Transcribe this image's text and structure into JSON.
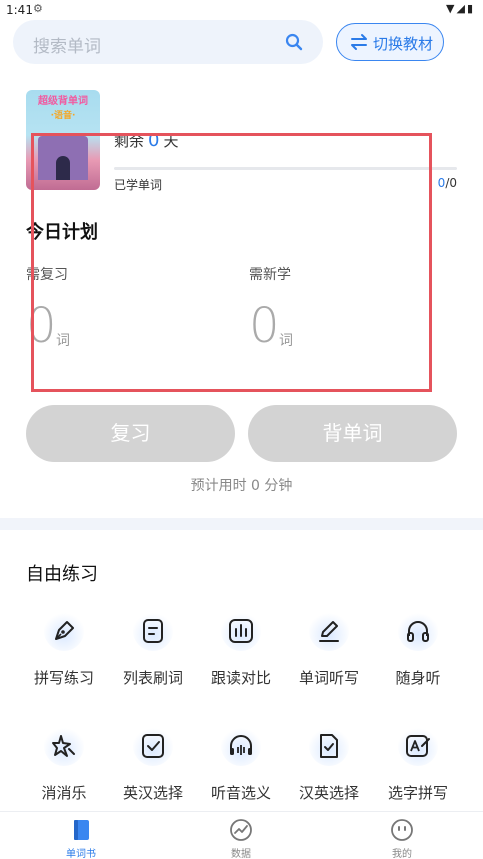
{
  "status_bar": {
    "time": "1:41"
  },
  "search": {
    "placeholder": "搜索单词"
  },
  "switch_button": {
    "label": "切换教材"
  },
  "book": {
    "cover_title": "超级背单词",
    "cover_subtitle": "·语音·"
  },
  "progress": {
    "remaining_prefix": "剩余",
    "remaining_days": "0",
    "remaining_suffix": "天",
    "learned_label": "已学单词",
    "learned_done": "0",
    "learned_total": "/0",
    "fraction": 0
  },
  "plan": {
    "title": "今日计划",
    "review_label": "需复习",
    "review_value": "0",
    "new_label": "需新学",
    "new_value": "0",
    "unit": "词"
  },
  "actions": {
    "review_button": "复习",
    "study_button": "背单词",
    "estimate": "预计用时 0 分钟"
  },
  "practice": {
    "title": "自由练习",
    "items": [
      {
        "label": "拼写练习",
        "icon": "pen-nib-icon"
      },
      {
        "label": "列表刷词",
        "icon": "list-card-icon"
      },
      {
        "label": "跟读对比",
        "icon": "audio-bars-icon"
      },
      {
        "label": "单词听写",
        "icon": "pencil-line-icon"
      },
      {
        "label": "随身听",
        "icon": "headphones-icon"
      },
      {
        "label": "消消乐",
        "icon": "sparkle-star-icon"
      },
      {
        "label": "英汉选择",
        "icon": "check-square-icon"
      },
      {
        "label": "听音选义",
        "icon": "headset-wave-icon"
      },
      {
        "label": "汉英选择",
        "icon": "check-document-icon"
      },
      {
        "label": "选字拼写",
        "icon": "spell-edit-icon"
      }
    ]
  },
  "tabbar": {
    "tabs": [
      {
        "label": "单词书",
        "icon": "book-icon",
        "active": true
      },
      {
        "label": "数据",
        "icon": "chart-trend-icon",
        "active": false
      },
      {
        "label": "我的",
        "icon": "smiley-icon",
        "active": false
      }
    ]
  },
  "colors": {
    "accent": "#2b7be8",
    "disabled_button": "#d3d3d3",
    "annotation": "#e5535c"
  }
}
